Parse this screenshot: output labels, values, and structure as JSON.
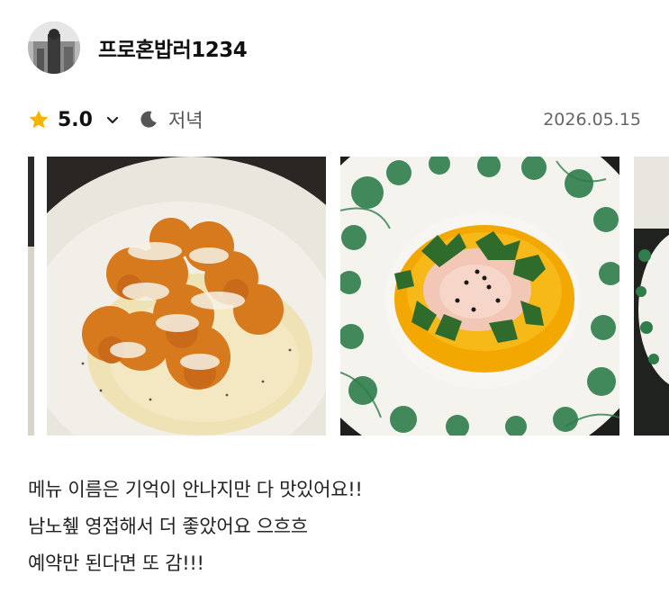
{
  "review": {
    "username": "프로혼밥러1234",
    "rating": "5.0",
    "meal_time": "저녁",
    "date": "2026.05.15",
    "text_lines": [
      "메뉴 이름은 기억이 안나지만 다 맛있어요!!",
      "남노췦 영접해서 더 좋았어요 으흐흐",
      "예약만 된다면 또 감!!!"
    ]
  },
  "icons": {
    "rating_star": "star-icon",
    "rating_toggle": "chevron-down-icon",
    "meal_time": "moon-icon"
  },
  "colors": {
    "star": "#F5B400",
    "text": "#111111",
    "muted": "#666666",
    "plate_pattern": "#2E7D4A",
    "sauce_yellow": "#F2A800"
  },
  "photos": [
    {
      "subject": "photo-partial-left"
    },
    {
      "subject": "fried-croquettes-with-cheese"
    },
    {
      "subject": "raw-fish-with-citrus-sauce"
    },
    {
      "subject": "photo-partial-right"
    }
  ]
}
